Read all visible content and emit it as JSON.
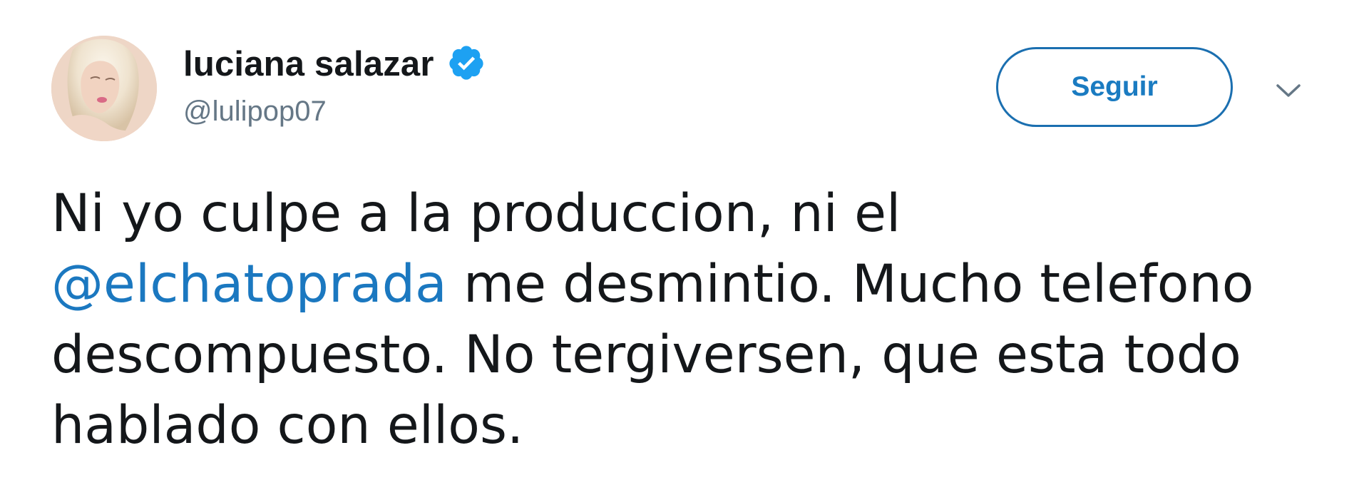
{
  "tweet": {
    "author": {
      "display_name": "luciana salazar",
      "handle": "@lulipop07",
      "verified": true
    },
    "follow_button_label": "Seguir",
    "text_before_mention": "Ni yo culpe a la produccion, ni el",
    "mention": "@elchatoprada",
    "text_after_mention": "me desmintio. Mucho telefono descompuesto. No tergiversen, que esta todo hablado con ellos.",
    "icons": {
      "verified": "verified-badge-icon",
      "menu": "chevron-down-icon"
    }
  },
  "colors": {
    "link": "#1b78c0",
    "verified": "#1da1f2",
    "handle_gray": "#657786",
    "text": "#14171a"
  }
}
